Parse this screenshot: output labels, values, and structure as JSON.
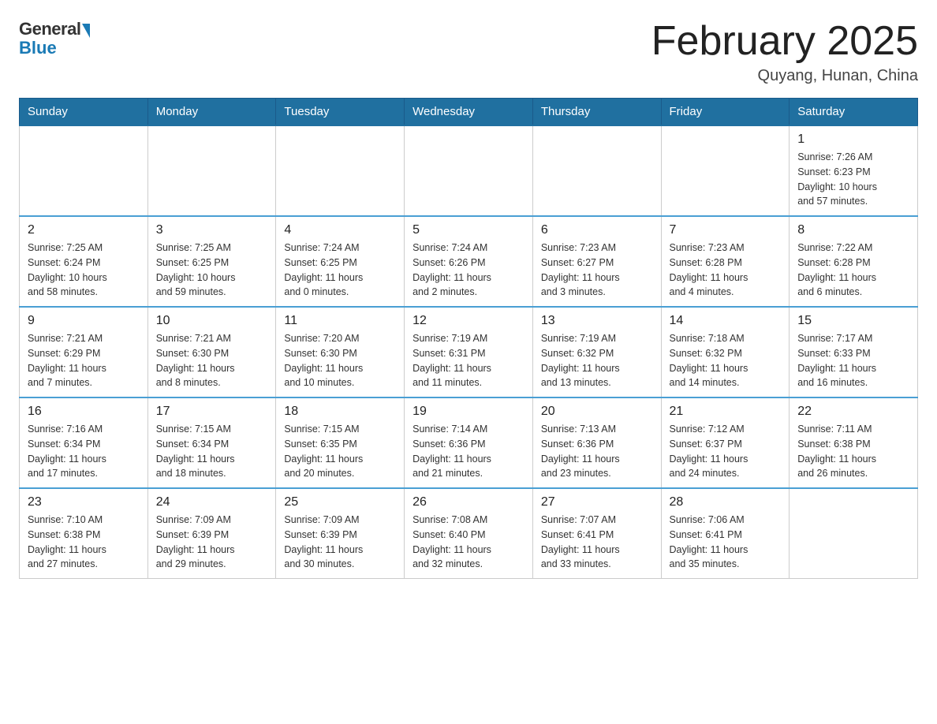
{
  "header": {
    "logo": {
      "general": "General",
      "blue": "Blue"
    },
    "title": "February 2025",
    "location": "Quyang, Hunan, China"
  },
  "weekdays": [
    "Sunday",
    "Monday",
    "Tuesday",
    "Wednesday",
    "Thursday",
    "Friday",
    "Saturday"
  ],
  "weeks": [
    [
      {
        "day": "",
        "info": ""
      },
      {
        "day": "",
        "info": ""
      },
      {
        "day": "",
        "info": ""
      },
      {
        "day": "",
        "info": ""
      },
      {
        "day": "",
        "info": ""
      },
      {
        "day": "",
        "info": ""
      },
      {
        "day": "1",
        "info": "Sunrise: 7:26 AM\nSunset: 6:23 PM\nDaylight: 10 hours\nand 57 minutes."
      }
    ],
    [
      {
        "day": "2",
        "info": "Sunrise: 7:25 AM\nSunset: 6:24 PM\nDaylight: 10 hours\nand 58 minutes."
      },
      {
        "day": "3",
        "info": "Sunrise: 7:25 AM\nSunset: 6:25 PM\nDaylight: 10 hours\nand 59 minutes."
      },
      {
        "day": "4",
        "info": "Sunrise: 7:24 AM\nSunset: 6:25 PM\nDaylight: 11 hours\nand 0 minutes."
      },
      {
        "day": "5",
        "info": "Sunrise: 7:24 AM\nSunset: 6:26 PM\nDaylight: 11 hours\nand 2 minutes."
      },
      {
        "day": "6",
        "info": "Sunrise: 7:23 AM\nSunset: 6:27 PM\nDaylight: 11 hours\nand 3 minutes."
      },
      {
        "day": "7",
        "info": "Sunrise: 7:23 AM\nSunset: 6:28 PM\nDaylight: 11 hours\nand 4 minutes."
      },
      {
        "day": "8",
        "info": "Sunrise: 7:22 AM\nSunset: 6:28 PM\nDaylight: 11 hours\nand 6 minutes."
      }
    ],
    [
      {
        "day": "9",
        "info": "Sunrise: 7:21 AM\nSunset: 6:29 PM\nDaylight: 11 hours\nand 7 minutes."
      },
      {
        "day": "10",
        "info": "Sunrise: 7:21 AM\nSunset: 6:30 PM\nDaylight: 11 hours\nand 8 minutes."
      },
      {
        "day": "11",
        "info": "Sunrise: 7:20 AM\nSunset: 6:30 PM\nDaylight: 11 hours\nand 10 minutes."
      },
      {
        "day": "12",
        "info": "Sunrise: 7:19 AM\nSunset: 6:31 PM\nDaylight: 11 hours\nand 11 minutes."
      },
      {
        "day": "13",
        "info": "Sunrise: 7:19 AM\nSunset: 6:32 PM\nDaylight: 11 hours\nand 13 minutes."
      },
      {
        "day": "14",
        "info": "Sunrise: 7:18 AM\nSunset: 6:32 PM\nDaylight: 11 hours\nand 14 minutes."
      },
      {
        "day": "15",
        "info": "Sunrise: 7:17 AM\nSunset: 6:33 PM\nDaylight: 11 hours\nand 16 minutes."
      }
    ],
    [
      {
        "day": "16",
        "info": "Sunrise: 7:16 AM\nSunset: 6:34 PM\nDaylight: 11 hours\nand 17 minutes."
      },
      {
        "day": "17",
        "info": "Sunrise: 7:15 AM\nSunset: 6:34 PM\nDaylight: 11 hours\nand 18 minutes."
      },
      {
        "day": "18",
        "info": "Sunrise: 7:15 AM\nSunset: 6:35 PM\nDaylight: 11 hours\nand 20 minutes."
      },
      {
        "day": "19",
        "info": "Sunrise: 7:14 AM\nSunset: 6:36 PM\nDaylight: 11 hours\nand 21 minutes."
      },
      {
        "day": "20",
        "info": "Sunrise: 7:13 AM\nSunset: 6:36 PM\nDaylight: 11 hours\nand 23 minutes."
      },
      {
        "day": "21",
        "info": "Sunrise: 7:12 AM\nSunset: 6:37 PM\nDaylight: 11 hours\nand 24 minutes."
      },
      {
        "day": "22",
        "info": "Sunrise: 7:11 AM\nSunset: 6:38 PM\nDaylight: 11 hours\nand 26 minutes."
      }
    ],
    [
      {
        "day": "23",
        "info": "Sunrise: 7:10 AM\nSunset: 6:38 PM\nDaylight: 11 hours\nand 27 minutes."
      },
      {
        "day": "24",
        "info": "Sunrise: 7:09 AM\nSunset: 6:39 PM\nDaylight: 11 hours\nand 29 minutes."
      },
      {
        "day": "25",
        "info": "Sunrise: 7:09 AM\nSunset: 6:39 PM\nDaylight: 11 hours\nand 30 minutes."
      },
      {
        "day": "26",
        "info": "Sunrise: 7:08 AM\nSunset: 6:40 PM\nDaylight: 11 hours\nand 32 minutes."
      },
      {
        "day": "27",
        "info": "Sunrise: 7:07 AM\nSunset: 6:41 PM\nDaylight: 11 hours\nand 33 minutes."
      },
      {
        "day": "28",
        "info": "Sunrise: 7:06 AM\nSunset: 6:41 PM\nDaylight: 11 hours\nand 35 minutes."
      },
      {
        "day": "",
        "info": ""
      }
    ]
  ]
}
